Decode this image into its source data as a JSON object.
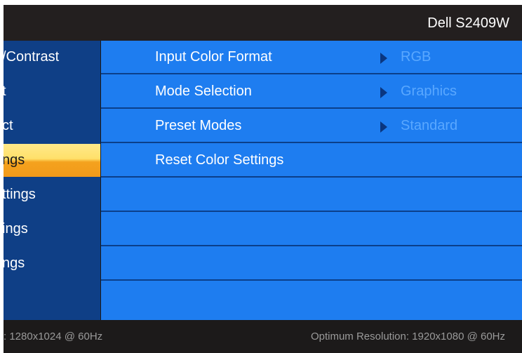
{
  "header": {
    "model": "Dell S2409W"
  },
  "left_menu": {
    "items": [
      {
        "label": "/Contrast"
      },
      {
        "label": "t"
      },
      {
        "label": "ct"
      },
      {
        "label": "ngs"
      },
      {
        "label": "ttings"
      },
      {
        "label": "ings"
      },
      {
        "label": "ngs"
      },
      {
        "label": ""
      }
    ],
    "selected_index": 3
  },
  "right_menu": {
    "rows": [
      {
        "label": "Input Color Format",
        "value": "RGB"
      },
      {
        "label": "Mode Selection",
        "value": "Graphics"
      },
      {
        "label": "Preset Modes",
        "value": "Standard"
      },
      {
        "label": "Reset Color Settings",
        "value": ""
      },
      {
        "label": "",
        "value": ""
      },
      {
        "label": "",
        "value": ""
      },
      {
        "label": "",
        "value": ""
      },
      {
        "label": "",
        "value": ""
      }
    ]
  },
  "footer": {
    "current_resolution": ": 1280x1024 @ 60Hz",
    "optimum_resolution": "Optimum Resolution: 1920x1080 @ 60Hz"
  },
  "colors": {
    "panel_blue": "#1e7df0",
    "left_blue": "#0f3f86",
    "selected_gradient_top": "#ffe06a",
    "selected_gradient_bottom": "#f29a1a",
    "value_text": "#5aa8ff"
  },
  "icons": {
    "row_arrow": "triangle-right-icon"
  }
}
